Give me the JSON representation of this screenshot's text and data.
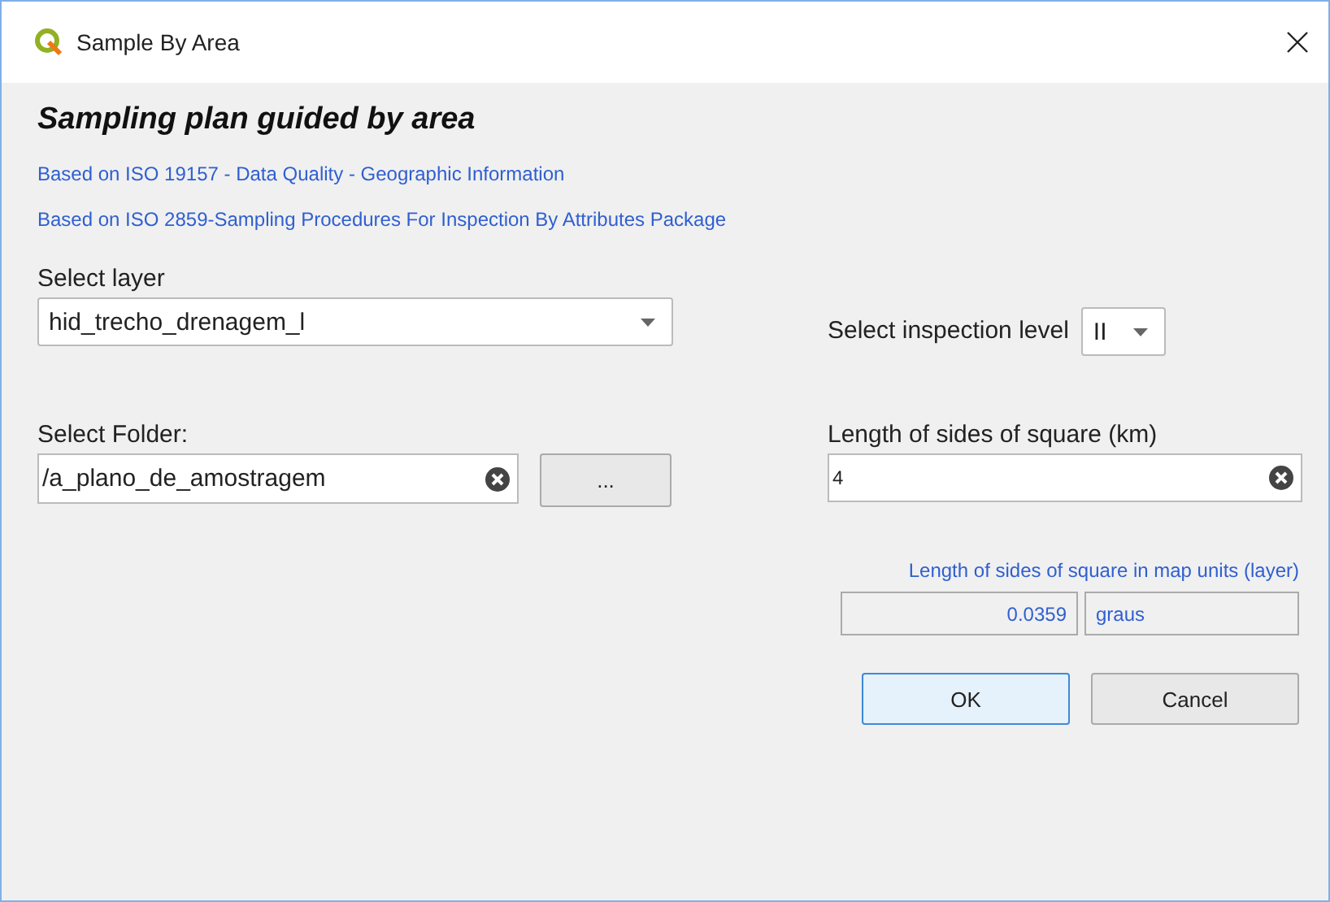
{
  "window": {
    "title": "Sample By Area"
  },
  "heading": "Sampling plan guided by area",
  "references": [
    "Based on ISO 19157 - Data Quality - Geographic Information",
    "Based on ISO 2859-Sampling Procedures For Inspection By Attributes Package"
  ],
  "layer": {
    "label": "Select layer",
    "value": "hid_trecho_drenagem_l"
  },
  "inspection_level": {
    "label": "Select inspection level",
    "value": "II"
  },
  "folder": {
    "label": "Select Folder:",
    "value": "/a_plano_de_amostragem",
    "browse_button": "..."
  },
  "square_length": {
    "label": "Length of sides of square (km)",
    "value": "4"
  },
  "map_units": {
    "label": "Length of sides of square in map units (layer)",
    "value": "0.0359",
    "unit": "graus"
  },
  "buttons": [
    {
      "label": "OK",
      "default": true
    },
    {
      "label": "Cancel",
      "default": false
    }
  ]
}
